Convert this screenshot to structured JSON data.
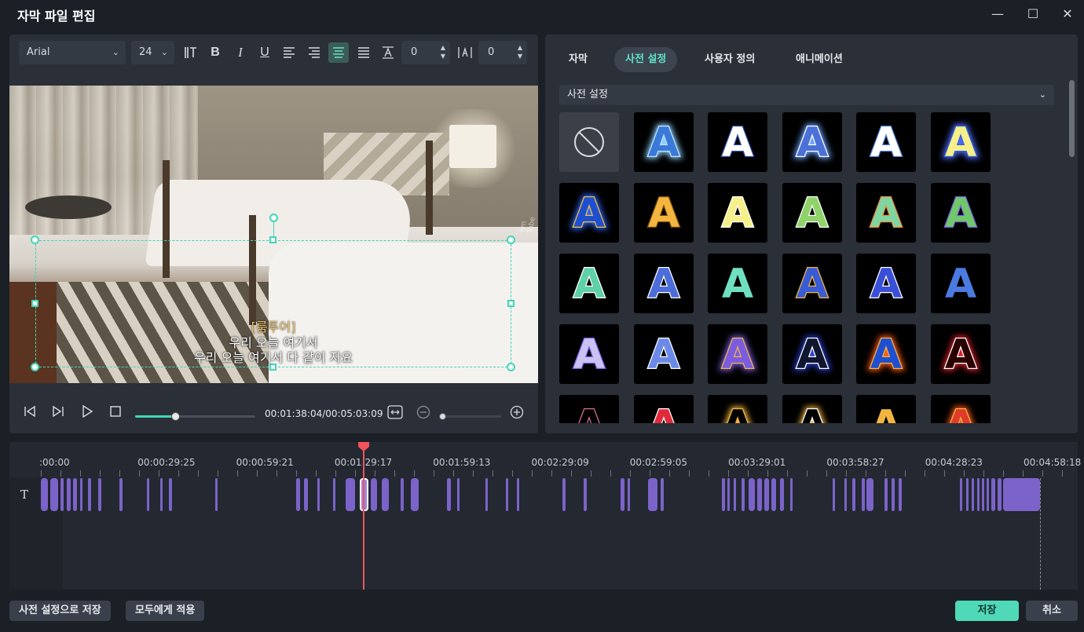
{
  "window": {
    "title": "자막 파일 편집",
    "controls": {
      "minimize": "—",
      "maximize": "☐",
      "close": "✕"
    }
  },
  "toolbar": {
    "font_family": "Arial",
    "font_size": "24",
    "bold": "B",
    "italic": "I",
    "underline": "U",
    "char_spacing_value": "0",
    "line_spacing_value": "0"
  },
  "preview": {
    "speaker_tag": "[룸투어]",
    "subtitle_line1": "우리 오늘 여기서",
    "subtitle_line2": "우리 오늘 여기서 다 같이 자요",
    "watermark": "Ijm Tube"
  },
  "player": {
    "timecode": "00:01:38:04/00:05:03:09",
    "progress": 0.34,
    "zoom": 0.0
  },
  "presets_panel": {
    "tabs": [
      {
        "label": "자막",
        "active": false
      },
      {
        "label": "사전 설정",
        "active": true
      },
      {
        "label": "사용자 정의",
        "active": false
      },
      {
        "label": "애니메이션",
        "active": false
      }
    ],
    "category": "사전 설정",
    "preset_letter": "A",
    "presets": [
      {
        "fill": "#3a79d8",
        "stroke": "#bfe6ff",
        "glow": "#8fd1ff"
      },
      {
        "fill": "#ffffff",
        "stroke": "#2b4fa8",
        "glow": ""
      },
      {
        "fill": "#4b70d9",
        "stroke": "#ffffff",
        "glow": "#6aa6ff"
      },
      {
        "fill": "#ffffff",
        "stroke": "#4b7fd6",
        "glow": ""
      },
      {
        "fill": "#f6f08a",
        "stroke": "#3b5bd8",
        "glow": "#4b6cff"
      },
      {
        "fill": "#1f4fd1",
        "stroke": "#f2c23a",
        "glow": "#3366ff"
      },
      {
        "fill": "#f2b640",
        "stroke": "#7a4a0a",
        "glow": ""
      },
      {
        "fill": "#f6f08a",
        "stroke": "#ffffff",
        "glow": ""
      },
      {
        "fill": "#8fd36a",
        "stroke": "#ffffff",
        "glow": ""
      },
      {
        "fill": "#7fd6a0",
        "stroke": "#f09040",
        "glow": ""
      },
      {
        "fill": "#6fc86a",
        "stroke": "#7b5ce0",
        "glow": ""
      },
      {
        "fill": "#5fd0a8",
        "stroke": "#ffffff",
        "glow": ""
      },
      {
        "fill": "#4b6cd9",
        "stroke": "#ffffff",
        "glow": ""
      },
      {
        "fill": "#6fe0c0",
        "stroke": "#000000",
        "glow": ""
      },
      {
        "fill": "#3a5bd6",
        "stroke": "#f2b640",
        "glow": ""
      },
      {
        "fill": "#3a4fd8",
        "stroke": "#ffffff",
        "glow": ""
      },
      {
        "fill": "#4b7ae0",
        "stroke": "#000000",
        "glow": ""
      },
      {
        "fill": "#c9c2f2",
        "stroke": "#7b5ce0",
        "glow": ""
      },
      {
        "fill": "#6b8ae8",
        "stroke": "#ffffff",
        "glow": ""
      },
      {
        "fill": "#7b5ce0",
        "stroke": "#f2b640",
        "glow": "#7b5ce0"
      },
      {
        "fill": "#101630",
        "stroke": "#ffffff",
        "glow": "#2b3fd8"
      },
      {
        "fill": "#1f4fd1",
        "stroke": "#f2b640",
        "glow": "#ff5a1f"
      },
      {
        "fill": "#2a0000",
        "stroke": "#ffffff",
        "glow": "#e0202a"
      },
      {
        "fill": "#000000",
        "stroke": "#e06a9a",
        "glow": ""
      },
      {
        "fill": "#e02a3a",
        "stroke": "#ffffff",
        "glow": ""
      },
      {
        "fill": "#000000",
        "stroke": "#f2b640",
        "glow": "#f2b640"
      },
      {
        "fill": "#000000",
        "stroke": "#ffffff",
        "glow": "#f2b640"
      },
      {
        "fill": "#f2b640",
        "stroke": "#000000",
        "glow": ""
      },
      {
        "fill": "#e03a2a",
        "stroke": "#f2b640",
        "glow": "#ff5a1f"
      }
    ]
  },
  "timeline": {
    "ticks": [
      ":00:00",
      "00:00:29:25",
      "00:00:59:21",
      "00:01:29:17",
      "00:01:59:13",
      "00:02:29:09",
      "00:02:59:05",
      "00:03:29:01",
      "00:03:58:27",
      "00:04:28:23",
      "00:04:58:18"
    ],
    "track_icon": "T"
  },
  "footer": {
    "save_preset_label": "사전 설정으로 저장",
    "apply_all_label": "모두에게 적용",
    "save_label": "저장",
    "cancel_label": "취소"
  },
  "colors": {
    "accent": "#4fd9b9",
    "clip": "#7b63c9",
    "playhead": "#f2545b"
  }
}
